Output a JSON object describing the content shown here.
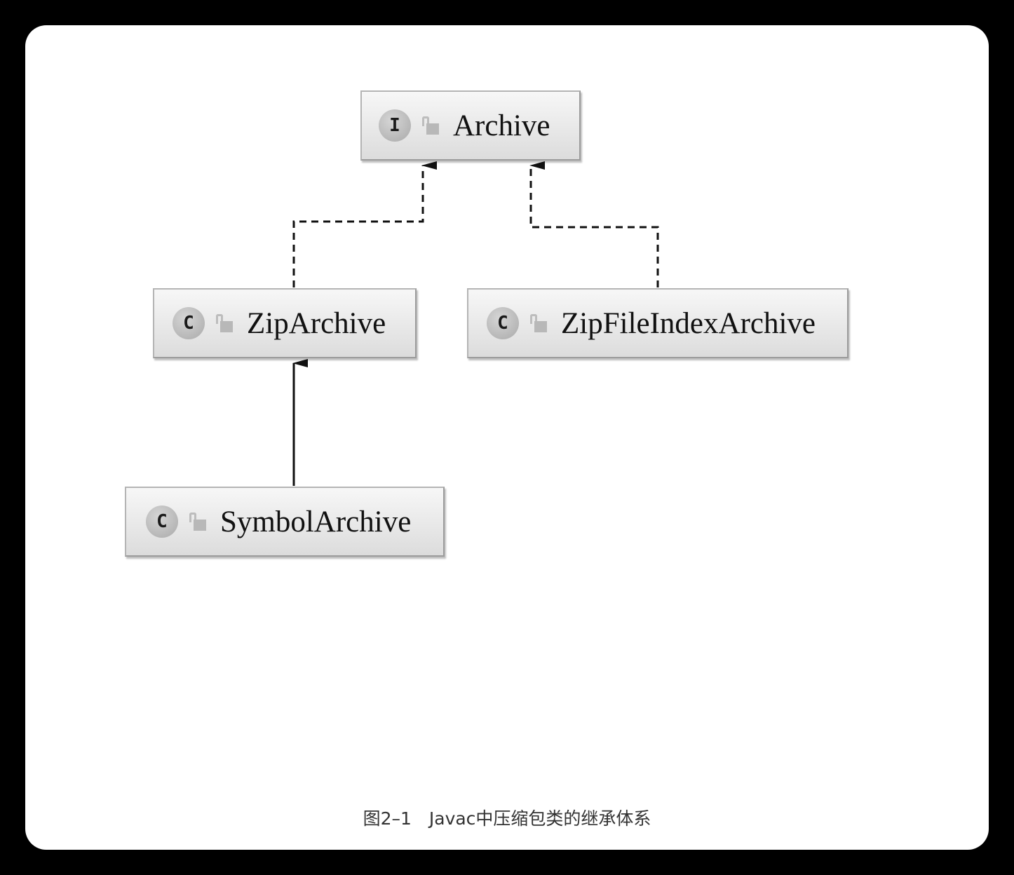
{
  "diagram": {
    "nodes": [
      {
        "id": "archive",
        "kind": "I",
        "kind_meaning": "interface",
        "name": "Archive"
      },
      {
        "id": "zip-archive",
        "kind": "C",
        "kind_meaning": "class",
        "name": "ZipArchive"
      },
      {
        "id": "zip-file-index-archive",
        "kind": "C",
        "kind_meaning": "class",
        "name": "ZipFileIndexArchive"
      },
      {
        "id": "symbol-archive",
        "kind": "C",
        "kind_meaning": "class",
        "name": "SymbolArchive"
      }
    ],
    "edges": [
      {
        "from": "zip-archive",
        "to": "archive",
        "relation": "implements",
        "style": "dashed"
      },
      {
        "from": "zip-file-index-archive",
        "to": "archive",
        "relation": "implements",
        "style": "dashed"
      },
      {
        "from": "symbol-archive",
        "to": "zip-archive",
        "relation": "extends",
        "style": "solid"
      }
    ],
    "icons": {
      "kind": "circle-letter-icon",
      "access": "lock-icon"
    }
  },
  "caption": "图2–1　Javac中压缩包类的继承体系"
}
